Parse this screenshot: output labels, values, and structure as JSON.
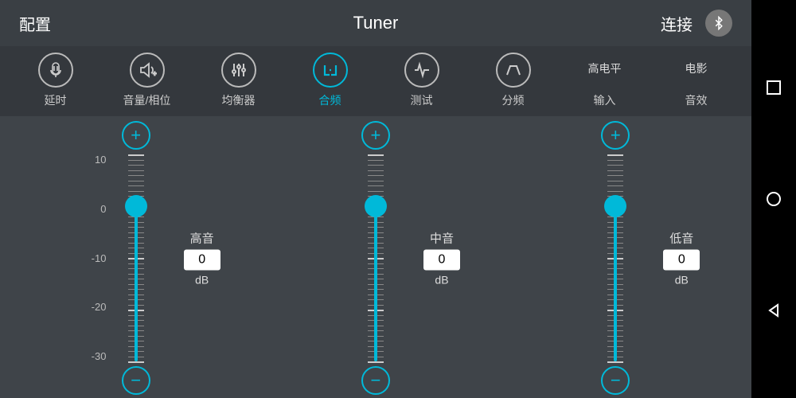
{
  "topbar": {
    "left": "配置",
    "title": "Tuner",
    "right": "连接"
  },
  "tabs": [
    {
      "id": "delay",
      "label": "延时",
      "icon": "mic"
    },
    {
      "id": "volume",
      "label": "音量/相位",
      "icon": "speaker"
    },
    {
      "id": "eq",
      "label": "均衡器",
      "icon": "sliders"
    },
    {
      "id": "cross",
      "label": "合频",
      "icon": "cross",
      "active": true
    },
    {
      "id": "test",
      "label": "测试",
      "icon": "pulse"
    },
    {
      "id": "xover",
      "label": "分频",
      "icon": "trapezoid"
    },
    {
      "id": "input",
      "label": "输入",
      "secondary": "高电平"
    },
    {
      "id": "sound",
      "label": "音效",
      "secondary": "电影"
    }
  ],
  "sliders": {
    "scale": [
      "10",
      "0",
      "-10",
      "-20",
      "-30"
    ],
    "min": -30,
    "max": 10,
    "unit": "dB",
    "channels": [
      {
        "id": "high",
        "label": "高音",
        "value": 0
      },
      {
        "id": "mid",
        "label": "中音",
        "value": 0
      },
      {
        "id": "low",
        "label": "低音",
        "value": 0
      }
    ]
  }
}
